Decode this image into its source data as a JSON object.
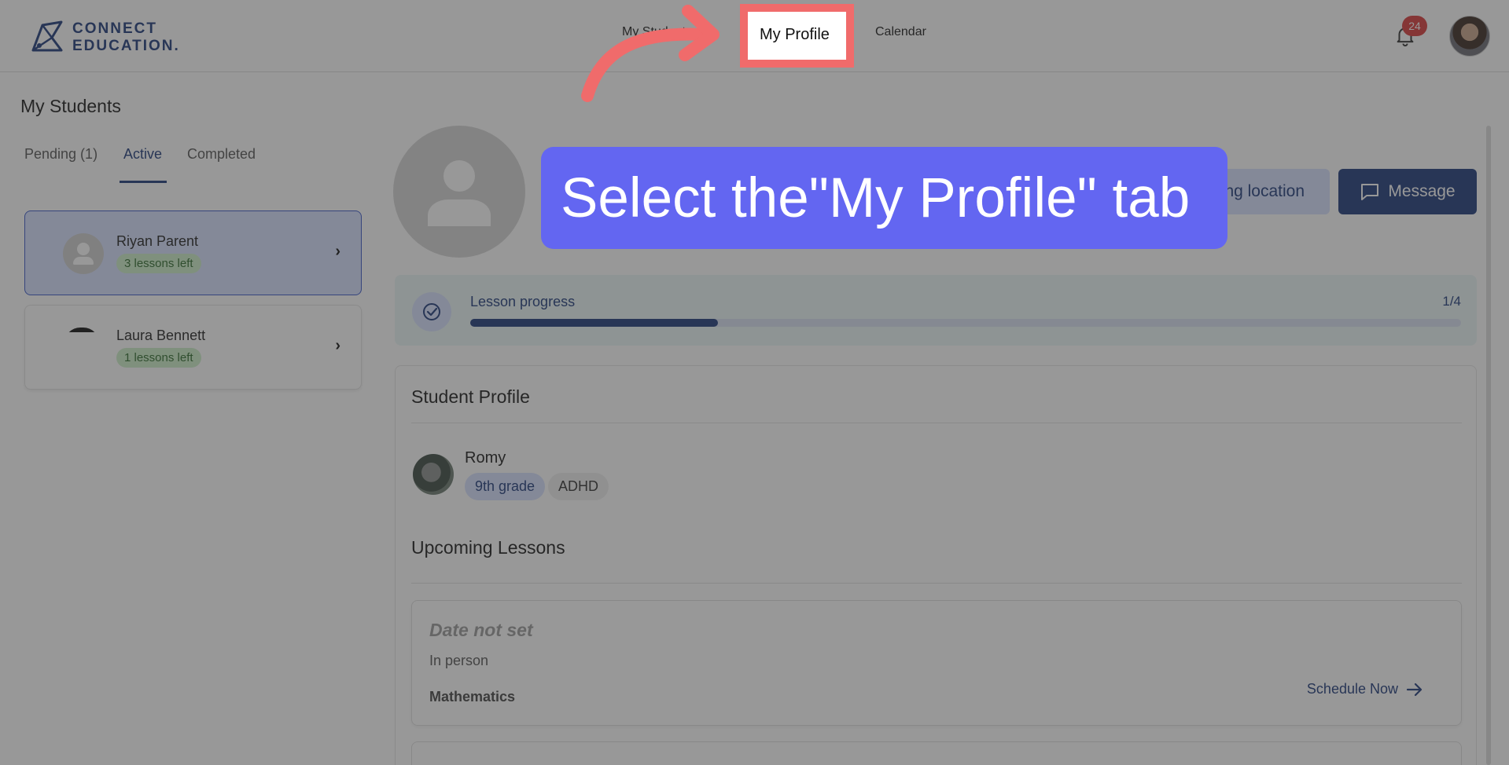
{
  "header": {
    "logo_line1": "CONNECT",
    "logo_line2": "EDUCATION.",
    "nav": {
      "students": "My Students",
      "profile": "My Profile",
      "calendar": "Calendar"
    },
    "notification_count": "24"
  },
  "sidebar": {
    "title": "My Students",
    "tabs": {
      "pending": "Pending (1)",
      "active": "Active",
      "completed": "Completed"
    },
    "students": [
      {
        "name": "Riyan Parent",
        "badge": "3 lessons left"
      },
      {
        "name": "Laura Bennett",
        "badge": "1 lessons left"
      }
    ]
  },
  "main": {
    "meeting_location_label": "ting location",
    "message_label": "Message",
    "progress": {
      "label": "Lesson progress",
      "count": "1/4",
      "fraction": 0.25
    },
    "student_profile": {
      "title": "Student Profile",
      "name": "Romy",
      "tags": [
        "9th grade",
        "ADHD"
      ]
    },
    "upcoming": {
      "title": "Upcoming Lessons",
      "lesson": {
        "date": "Date not set",
        "mode": "In person",
        "subject": "Mathematics",
        "action": "Schedule Now"
      }
    }
  },
  "overlay": {
    "callout_text": "Select the\"My Profile\" tab",
    "highlight_color": "#f06b6b",
    "callout_color": "#6366f1"
  },
  "colors": {
    "brand": "#1f3a7a",
    "active_card": "#d7e1ff",
    "badge_green": "#cdeec9",
    "notification": "#d93a3a"
  }
}
